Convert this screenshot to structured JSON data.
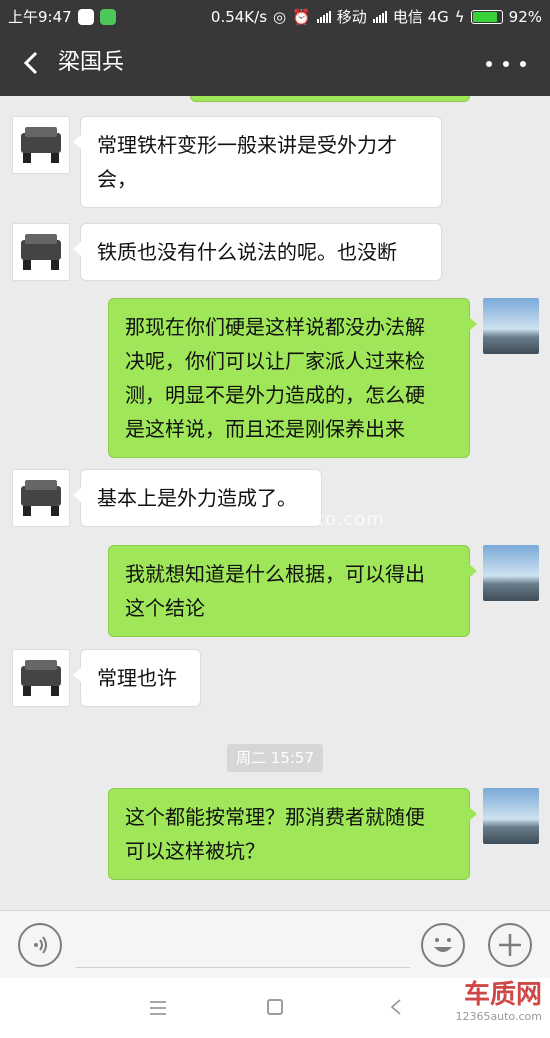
{
  "status": {
    "time": "上午9:47",
    "speed": "0.54K/s",
    "carrier1": "移动",
    "carrier2": "电信 4G",
    "battery": "92%",
    "battery_level": 0.92
  },
  "header": {
    "title": "梁国兵"
  },
  "messages": [
    {
      "side": "left",
      "text_lines": [
        "常理铁杆变形一般来讲是受外力才",
        "会，"
      ]
    },
    {
      "side": "left",
      "text_lines": [
        "铁质也没有什么说法的呢。也没断"
      ]
    },
    {
      "side": "right",
      "text_lines": [
        "那现在你们硬是这样说都没办法解",
        "决呢，你们可以让厂家派人过来检",
        "测，明显不是外力造成的，怎么硬",
        "是这样说，而且还是刚保养出来"
      ]
    },
    {
      "side": "left",
      "text_lines": [
        "基本上是外力造成了。"
      ]
    },
    {
      "side": "right",
      "text_lines": [
        "我就想知道是什么根据，可以得出",
        "这个结论"
      ]
    },
    {
      "side": "left",
      "text_lines": [
        "常理也许"
      ]
    },
    {
      "side": "right",
      "text_lines": [
        "这个都能按常理？那消费者就随便",
        "可以这样被坑？"
      ]
    }
  ],
  "time_divider": "周二 15:57",
  "watermark": "www.12365auto.com",
  "brand": {
    "main": "车质网",
    "sub": "12365auto.com"
  },
  "colors": {
    "header_bg": "#383838",
    "chat_bg": "#ebebeb",
    "bubble_right": "#9fe658",
    "bubble_left": "#ffffff",
    "brand_red": "#d04747"
  }
}
